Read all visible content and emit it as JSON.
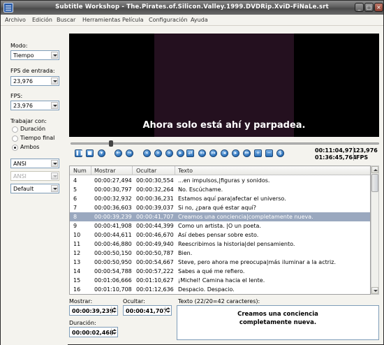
{
  "window": {
    "title": "Subtitle Workshop - The.Pirates.of.Silicon.Valley.1999.DVDRip.XviD-FiNaLe.srt",
    "controls": [
      "_",
      "□",
      "×"
    ]
  },
  "menu": [
    "Archivo",
    "Edición",
    "Buscar",
    "Herramientas",
    "Película",
    "Configuración",
    "Ayuda"
  ],
  "sidebar": {
    "mode_label": "Modo:",
    "mode_value": "Tiempo",
    "fps_input_label": "FPS de entrada:",
    "fps_input_value": "23,976",
    "fps_label": "FPS:",
    "fps_value": "23,976",
    "work_with_label": "Trabajar con:",
    "radios": [
      {
        "label": "Duración",
        "checked": false
      },
      {
        "label": "Tiempo final",
        "checked": false
      },
      {
        "label": "Ambos",
        "checked": true
      }
    ],
    "encoding_1": "ANSI",
    "encoding_2": "ANSI",
    "style_value": "Default"
  },
  "player": {
    "subtitle_text": "Ahora solo está ahí y parpadea.",
    "progress": 0.13,
    "current_time": "00:11:04,971",
    "total_time": "01:36:45,764",
    "fps": "23,976",
    "fps_unit": "FPS",
    "buttons": [
      "play-pause",
      "stop",
      "step",
      "back",
      "forward",
      "rewind",
      "fast-rewind",
      "fast-forward",
      "end",
      "sync-start",
      "sync-end",
      "set-start",
      "set-end",
      "start-sub",
      "end-sub",
      "prev",
      "next",
      "speed"
    ]
  },
  "grid": {
    "columns": [
      "Num",
      "Mostrar",
      "Ocultar",
      "Texto"
    ],
    "rows": [
      {
        "num": "4",
        "show": "00:00:27,494",
        "hide": "00:00:30,554",
        "text": "...en impulsos,|figuras y sonidos.",
        "selected": false
      },
      {
        "num": "5",
        "show": "00:00:30,797",
        "hide": "00:00:32,264",
        "text": "No. Escúchame.",
        "selected": false
      },
      {
        "num": "6",
        "show": "00:00:32,932",
        "hide": "00:00:36,231",
        "text": "Estamos aquí para|afectar el universo.",
        "selected": false
      },
      {
        "num": "7",
        "show": "00:00:36,603",
        "hide": "00:00:39,037",
        "text": "Si no, ¿para qué estar aquí?",
        "selected": false
      },
      {
        "num": "8",
        "show": "00:00:39,239",
        "hide": "00:00:41,707",
        "text": "Creamos una conciencia|completamente nueva.",
        "selected": true
      },
      {
        "num": "9",
        "show": "00:00:41,908",
        "hide": "00:00:44,399",
        "text": "Como un artista. |O un poeta.",
        "selected": false
      },
      {
        "num": "10",
        "show": "00:00:44,611",
        "hide": "00:00:46,670",
        "text": "Así debes pensar sobre esto.",
        "selected": false
      },
      {
        "num": "11",
        "show": "00:00:46,880",
        "hide": "00:00:49,940",
        "text": "Reescribimos la historia|del pensamiento.",
        "selected": false
      },
      {
        "num": "12",
        "show": "00:00:50,150",
        "hide": "00:00:50,787",
        "text": "Bien.",
        "selected": false
      },
      {
        "num": "13",
        "show": "00:00:50,950",
        "hide": "00:00:54,667",
        "text": "Steve, pero ahora me preocupa|más iluminar a la actriz.",
        "selected": false
      },
      {
        "num": "14",
        "show": "00:00:54,788",
        "hide": "00:00:57,222",
        "text": "Sabes a qué me refiero.",
        "selected": false
      },
      {
        "num": "15",
        "show": "00:01:06,666",
        "hide": "00:01:10,627",
        "text": "¡Michel! Camina hacia el lente.",
        "selected": false
      },
      {
        "num": "16",
        "show": "00:01:10,708",
        "hide": "00:01:12,636",
        "text": "Despacio. Despacio.",
        "selected": false
      }
    ]
  },
  "editor": {
    "show_label": "Mostrar:",
    "show_value": "00:00:39,239",
    "hide_label": "Ocultar:",
    "hide_value": "00:00:41,707",
    "duration_label": "Duración:",
    "duration_value": "00:00:02,468",
    "text_label": "Texto (22/20=42 caracteres):",
    "text_line1": "Creamos una conciencia",
    "text_line2": "completamente nueva."
  }
}
